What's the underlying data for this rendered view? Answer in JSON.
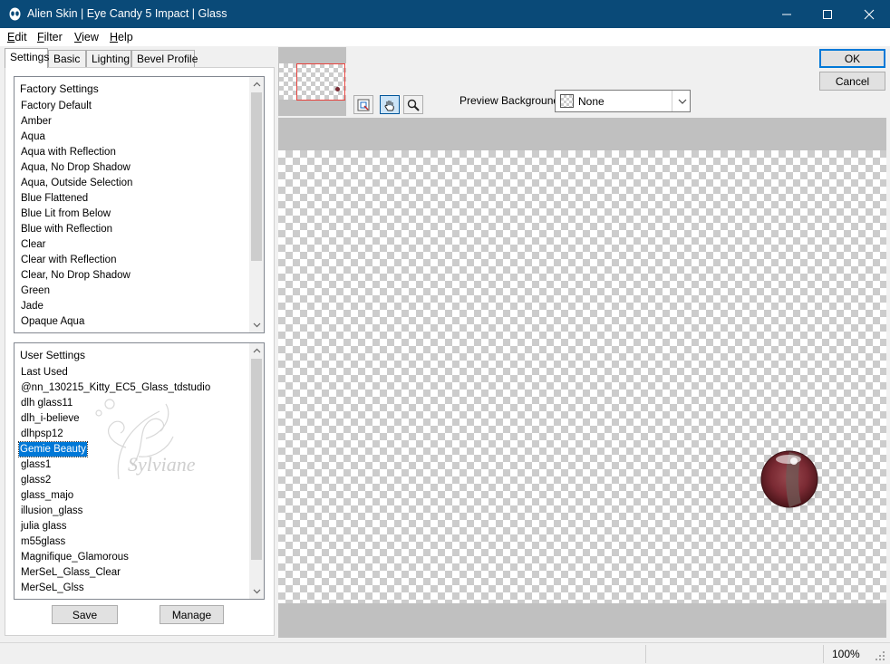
{
  "window": {
    "title": "Alien Skin | Eye Candy 5 Impact | Glass",
    "title_bar_color": "#0a4a78",
    "controls": [
      "minimize-icon",
      "maximize-icon",
      "close-icon"
    ]
  },
  "menu": [
    {
      "first": "E",
      "rest": "dit"
    },
    {
      "first": "F",
      "rest": "ilter"
    },
    {
      "first": "V",
      "rest": "iew"
    },
    {
      "first": "H",
      "rest": "elp"
    }
  ],
  "tabs": [
    "Settings",
    "Basic",
    "Lighting",
    "Bevel Profile"
  ],
  "factory_settings": {
    "header": "Factory Settings",
    "items": [
      "Factory Default",
      "Amber",
      "Aqua",
      "Aqua with Reflection",
      "Aqua, No Drop Shadow",
      "Aqua, Outside Selection",
      "Blue Flattened",
      "Blue Lit from Below",
      "Blue with Reflection",
      "Clear",
      "Clear with Reflection",
      "Clear, No Drop Shadow",
      "Green",
      "Jade",
      "Opaque Aqua"
    ]
  },
  "user_settings": {
    "header": "User Settings",
    "items": [
      "Last Used",
      "@nn_130215_Kitty_EC5_Glass_tdstudio",
      "dlh glass11",
      "dlh_i-believe",
      "dlhpsp12",
      "Gemie Beauty",
      "glass1",
      "glass2",
      "glass_majo",
      "illusion_glass",
      "julia glass",
      "m55glass",
      "Magnifique_Glamorous",
      "MerSeL_Glass_Clear",
      "MerSeL_Glss"
    ],
    "selected": "Gemie Beauty"
  },
  "buttons": {
    "save": "Save",
    "manage": "Manage",
    "ok": "OK",
    "cancel": "Cancel"
  },
  "preview": {
    "background_label": "Preview Background:",
    "background_value": "None",
    "tools": [
      "navigate-icon",
      "hand-icon",
      "zoom-icon"
    ],
    "active_tool": "hand-icon",
    "watermark_text": "Sylviane",
    "navigator_frame_color": "#e8413c",
    "glass_color": "#7a2a33"
  },
  "status": {
    "zoom": "100%"
  },
  "colors": {
    "selection": "#0078d7",
    "accent": "#0078d7"
  }
}
